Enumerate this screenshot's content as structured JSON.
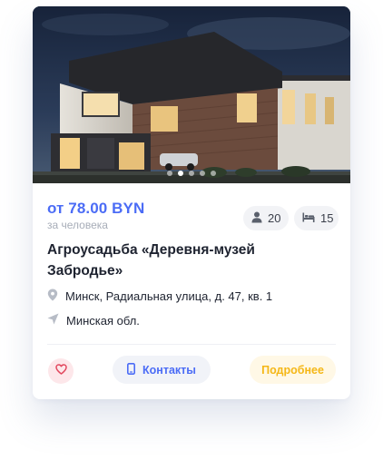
{
  "listing": {
    "price": "от 78.00 BYN",
    "price_note": "за человека",
    "guests": "20",
    "beds": "15",
    "title": "Агроусадьба «Деревня-музей Забродье»",
    "address": "Минск, Радиальная улица, д. 47, кв. 1",
    "region": "Минская обл."
  },
  "gallery": {
    "total": 5,
    "active_index": 1
  },
  "actions": {
    "contacts_label": "Контакты",
    "more_label": "Подробнее"
  },
  "colors": {
    "accent": "#4b6cf6",
    "favorite_bg": "#fde7ea",
    "favorite_icon": "#e2485e",
    "more_text": "#f5b716",
    "more_bg": "#fff8e6"
  },
  "icons": {
    "guests": "person-icon",
    "beds": "bed-icon",
    "address": "map-pin-icon",
    "region": "navigation-arrow-icon",
    "favorite": "heart-icon",
    "contacts": "phone-icon"
  }
}
